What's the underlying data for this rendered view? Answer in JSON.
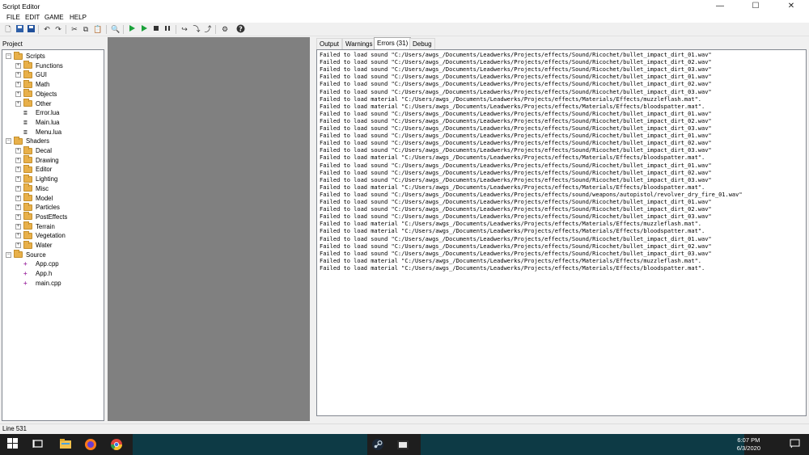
{
  "window": {
    "title": "Script Editor",
    "minimize": "—",
    "maximize": "☐",
    "close": "✕"
  },
  "menu": [
    "FILE",
    "EDIT",
    "GAME",
    "HELP"
  ],
  "toolbar": {
    "icons": [
      "new-file-icon",
      "save-all-icon",
      "save-icon",
      "undo-icon",
      "redo-icon",
      "cut-icon",
      "copy-icon",
      "paste-icon",
      "find-icon",
      "run-icon",
      "debug-run-icon",
      "stop-icon",
      "pause-icon",
      "step-over-icon",
      "step-into-icon",
      "step-out-icon",
      "settings-icon",
      "help-icon"
    ]
  },
  "project": {
    "label": "Project",
    "tree": [
      {
        "label": "Scripts",
        "type": "folder",
        "level": 0,
        "expanded": true
      },
      {
        "label": "Functions",
        "type": "folder",
        "level": 1
      },
      {
        "label": "GUI",
        "type": "folder",
        "level": 1
      },
      {
        "label": "Math",
        "type": "folder",
        "level": 1
      },
      {
        "label": "Objects",
        "type": "folder",
        "level": 1
      },
      {
        "label": "Other",
        "type": "folder",
        "level": 1
      },
      {
        "label": "Error.lua",
        "type": "lua",
        "level": 1
      },
      {
        "label": "Main.lua",
        "type": "lua",
        "level": 1
      },
      {
        "label": "Menu.lua",
        "type": "lua",
        "level": 1
      },
      {
        "label": "Shaders",
        "type": "folder",
        "level": 0,
        "expanded": true
      },
      {
        "label": "Decal",
        "type": "folder",
        "level": 1
      },
      {
        "label": "Drawing",
        "type": "folder",
        "level": 1
      },
      {
        "label": "Editor",
        "type": "folder",
        "level": 1
      },
      {
        "label": "Lighting",
        "type": "folder",
        "level": 1
      },
      {
        "label": "Misc",
        "type": "folder",
        "level": 1
      },
      {
        "label": "Model",
        "type": "folder",
        "level": 1
      },
      {
        "label": "Particles",
        "type": "folder",
        "level": 1
      },
      {
        "label": "PostEffects",
        "type": "folder",
        "level": 1
      },
      {
        "label": "Terrain",
        "type": "folder",
        "level": 1
      },
      {
        "label": "Vegetation",
        "type": "folder",
        "level": 1
      },
      {
        "label": "Water",
        "type": "folder",
        "level": 1
      },
      {
        "label": "Source",
        "type": "folder",
        "level": 0,
        "expanded": true
      },
      {
        "label": "App.cpp",
        "type": "cpp",
        "level": 1
      },
      {
        "label": "App.h",
        "type": "cpp",
        "level": 1
      },
      {
        "label": "main.cpp",
        "type": "cpp",
        "level": 1
      }
    ]
  },
  "tabs": [
    "Output",
    "Warnings",
    "Errors (31)",
    "Debug"
  ],
  "active_tab": "Errors (31)",
  "log": [
    "Failed to load sound \"C:/Users/awgs_/Documents/Leadwerks/Projects/effects/Sound/Ricochet/bullet_impact_dirt_01.wav\"",
    "Failed to load sound \"C:/Users/awgs_/Documents/Leadwerks/Projects/effects/Sound/Ricochet/bullet_impact_dirt_02.wav\"",
    "Failed to load sound \"C:/Users/awgs_/Documents/Leadwerks/Projects/effects/Sound/Ricochet/bullet_impact_dirt_03.wav\"",
    "Failed to load sound \"C:/Users/awgs_/Documents/Leadwerks/Projects/effects/Sound/Ricochet/bullet_impact_dirt_01.wav\"",
    "Failed to load sound \"C:/Users/awgs_/Documents/Leadwerks/Projects/effects/Sound/Ricochet/bullet_impact_dirt_02.wav\"",
    "Failed to load sound \"C:/Users/awgs_/Documents/Leadwerks/Projects/effects/Sound/Ricochet/bullet_impact_dirt_03.wav\"",
    "Failed to load material \"C:/Users/awgs_/Documents/Leadwerks/Projects/effects/Materials/Effects/muzzleflash.mat\".",
    "Failed to load material \"C:/Users/awgs_/Documents/Leadwerks/Projects/effects/Materials/Effects/bloodspatter.mat\".",
    "Failed to load sound \"C:/Users/awgs_/Documents/Leadwerks/Projects/effects/Sound/Ricochet/bullet_impact_dirt_01.wav\"",
    "Failed to load sound \"C:/Users/awgs_/Documents/Leadwerks/Projects/effects/Sound/Ricochet/bullet_impact_dirt_02.wav\"",
    "Failed to load sound \"C:/Users/awgs_/Documents/Leadwerks/Projects/effects/Sound/Ricochet/bullet_impact_dirt_03.wav\"",
    "Failed to load sound \"C:/Users/awgs_/Documents/Leadwerks/Projects/effects/Sound/Ricochet/bullet_impact_dirt_01.wav\"",
    "Failed to load sound \"C:/Users/awgs_/Documents/Leadwerks/Projects/effects/Sound/Ricochet/bullet_impact_dirt_02.wav\"",
    "Failed to load sound \"C:/Users/awgs_/Documents/Leadwerks/Projects/effects/Sound/Ricochet/bullet_impact_dirt_03.wav\"",
    "Failed to load material \"C:/Users/awgs_/Documents/Leadwerks/Projects/effects/Materials/Effects/bloodspatter.mat\".",
    "Failed to load sound \"C:/Users/awgs_/Documents/Leadwerks/Projects/effects/Sound/Ricochet/bullet_impact_dirt_01.wav\"",
    "Failed to load sound \"C:/Users/awgs_/Documents/Leadwerks/Projects/effects/Sound/Ricochet/bullet_impact_dirt_02.wav\"",
    "Failed to load sound \"C:/Users/awgs_/Documents/Leadwerks/Projects/effects/Sound/Ricochet/bullet_impact_dirt_03.wav\"",
    "Failed to load material \"C:/Users/awgs_/Documents/Leadwerks/Projects/effects/Materials/Effects/bloodspatter.mat\".",
    "Failed to load sound \"C:/Users/awgs_/Documents/Leadwerks/Projects/effects/sound/weapons/autopistol/revolver_dry_fire_01.wav\"",
    "Failed to load sound \"C:/Users/awgs_/Documents/Leadwerks/Projects/effects/Sound/Ricochet/bullet_impact_dirt_01.wav\"",
    "Failed to load sound \"C:/Users/awgs_/Documents/Leadwerks/Projects/effects/Sound/Ricochet/bullet_impact_dirt_02.wav\"",
    "Failed to load sound \"C:/Users/awgs_/Documents/Leadwerks/Projects/effects/Sound/Ricochet/bullet_impact_dirt_03.wav\"",
    "Failed to load material \"C:/Users/awgs_/Documents/Leadwerks/Projects/effects/Materials/Effects/muzzleflash.mat\".",
    "Failed to load material \"C:/Users/awgs_/Documents/Leadwerks/Projects/effects/Materials/Effects/bloodspatter.mat\".",
    "Failed to load sound \"C:/Users/awgs_/Documents/Leadwerks/Projects/effects/Sound/Ricochet/bullet_impact_dirt_01.wav\"",
    "Failed to load sound \"C:/Users/awgs_/Documents/Leadwerks/Projects/effects/Sound/Ricochet/bullet_impact_dirt_02.wav\"",
    "Failed to load sound \"C:/Users/awgs_/Documents/Leadwerks/Projects/effects/Sound/Ricochet/bullet_impact_dirt_03.wav\"",
    "Failed to load material \"C:/Users/awgs_/Documents/Leadwerks/Projects/effects/Materials/Effects/muzzleflash.mat\".",
    "Failed to load material \"C:/Users/awgs_/Documents/Leadwerks/Projects/effects/Materials/Effects/bloodspatter.mat\"."
  ],
  "status": {
    "line": "Line 531"
  },
  "taskbar": {
    "time": "6:07 PM",
    "date": "6/3/2020",
    "apps": [
      "windows-start-icon",
      "task-view-icon",
      "file-explorer-icon",
      "firefox-icon",
      "chrome-icon",
      "steam-icon",
      "leadwerks-icon"
    ]
  },
  "colors": {
    "taskbar": "#0d3a45",
    "editor_bg": "#808080",
    "folder": "#e8b04a"
  }
}
